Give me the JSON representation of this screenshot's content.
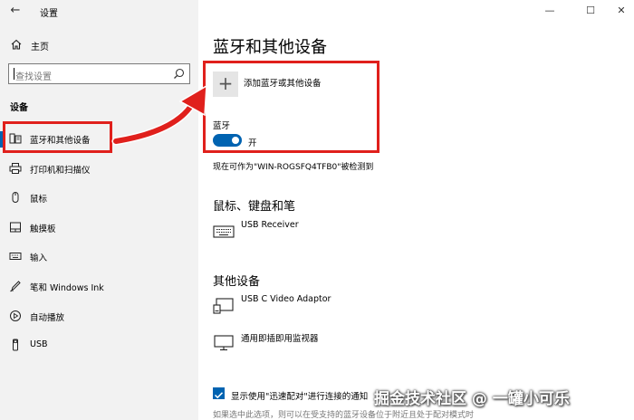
{
  "window": {
    "title": "设置",
    "controls": [
      "—",
      "☐",
      "✕"
    ]
  },
  "sidebar": {
    "home_label": "主页",
    "search_placeholder": "查找设置",
    "section_header": "设备",
    "items": [
      {
        "label": "蓝牙和其他设备",
        "icon": "bluetooth-devices-icon",
        "active": true
      },
      {
        "label": "打印机和扫描仪",
        "icon": "printer-icon"
      },
      {
        "label": "鼠标",
        "icon": "mouse-icon"
      },
      {
        "label": "触摸板",
        "icon": "touchpad-icon"
      },
      {
        "label": "输入",
        "icon": "keyboard-icon"
      },
      {
        "label": "笔和 Windows Ink",
        "icon": "pen-icon"
      },
      {
        "label": "自动播放",
        "icon": "autoplay-icon"
      },
      {
        "label": "USB",
        "icon": "usb-icon"
      }
    ]
  },
  "main": {
    "title": "蓝牙和其他设备",
    "add_device_label": "添加蓝牙或其他设备",
    "bluetooth_label": "蓝牙",
    "bluetooth_state": "开",
    "discoverable_text": "现在可作为\"WIN-ROGSFQ4TFB0\"被检测到",
    "mouse_section": "鼠标、键盘和笔",
    "mouse_devices": [
      {
        "name": "USB Receiver",
        "icon": "keyboard-icon"
      }
    ],
    "other_section": "其他设备",
    "other_devices": [
      {
        "name": "USB C Video Adaptor",
        "icon": "display-adapter-icon"
      },
      {
        "name": "通用即插即用监视器",
        "icon": "monitor-icon"
      }
    ],
    "swift_pair_label": "显示使用\"迅速配对\"进行连接的通知",
    "swift_pair_note": "如果选中此选项，则可以在受支持的蓝牙设备位于附近且处于配对模式时"
  },
  "overlay": {
    "watermark": "掘金技术社区 @ 一罐小可乐",
    "highlight_color": "#e0201c"
  },
  "colors": {
    "accent": "#0063b1",
    "sidebar_bg": "#f2f2f2"
  }
}
